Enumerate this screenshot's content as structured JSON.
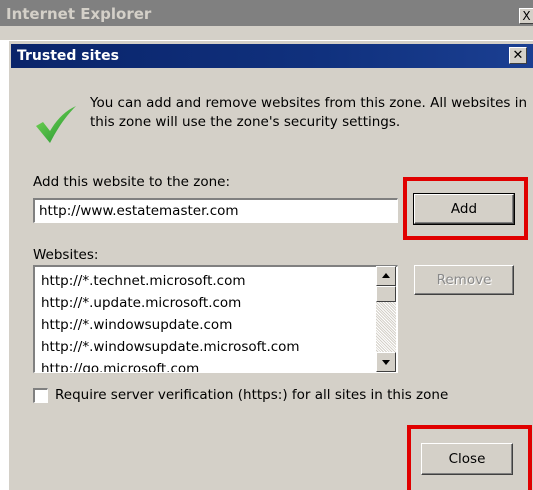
{
  "background_window": {
    "title": "Internet Explorer",
    "close_glyph": "X"
  },
  "dialog": {
    "title": "Trusted sites",
    "close_glyph": "✕",
    "description": "You can add and remove websites from this zone. All websites in this zone will use the zone's security settings.",
    "icon": "green-checkmark-icon"
  },
  "add_section": {
    "label": "Add this website to the zone:",
    "url_value": "http://www.estatemaster.com",
    "add_button": "Add"
  },
  "websites_section": {
    "label": "Websites:",
    "sites": [
      "http://*.technet.microsoft.com",
      "http://*.update.microsoft.com",
      "http://*.windowsupdate.com",
      "http://*.windowsupdate.microsoft.com",
      "http://go.microsoft.com"
    ],
    "remove_button": "Remove"
  },
  "https_option": {
    "label": "Require server verification (https:) for all sites in this zone",
    "checked": false
  },
  "footer": {
    "close_button": "Close"
  },
  "colors": {
    "highlight": "#e00000",
    "title_bar": "#0a246a",
    "dialog_face": "#d4d0c8",
    "check_green": "#22a33a"
  }
}
